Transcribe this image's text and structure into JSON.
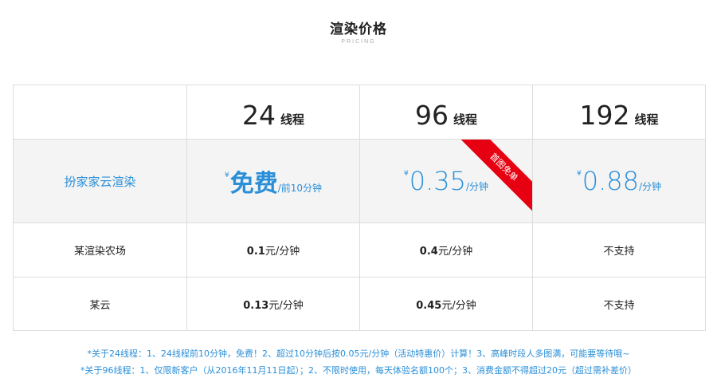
{
  "header": {
    "title": "渲染价格",
    "subtitle": "PRICING"
  },
  "table": {
    "columns": [
      {
        "threads": "24",
        "unit": "线程"
      },
      {
        "threads": "96",
        "unit": "线程"
      },
      {
        "threads": "192",
        "unit": "线程"
      }
    ],
    "ours": {
      "name": "扮家家云渲染",
      "prices": [
        {
          "currency": "¥",
          "value": "免费",
          "unit": "/前10分钟"
        },
        {
          "currency": "¥",
          "value": "0.35",
          "unit": "/分钟"
        },
        {
          "currency": "¥",
          "value": "0.88",
          "unit": "/分钟"
        }
      ],
      "ribbon": "首图免单"
    },
    "farm": {
      "name": "某渲染农场",
      "values": [
        {
          "value": "0.1",
          "unit": "元/分钟"
        },
        {
          "value": "0.4",
          "unit": "元/分钟"
        },
        {
          "value": "",
          "unit": "不支持"
        }
      ]
    },
    "cloud": {
      "name": "某云",
      "values": [
        {
          "value": "0.13",
          "unit": "元/分钟"
        },
        {
          "value": "0.45",
          "unit": "元/分钟"
        },
        {
          "value": "",
          "unit": "不支持"
        }
      ]
    }
  },
  "notes": [
    "*关于24线程：1、24线程前10分钟，免费！2、超过10分钟后按0.05元/分钟（活动特惠价）计算！3、高峰时段人多图满，可能要等待哦~",
    "*关于96线程：1、仅限新客户（从2016年11月11日起）；2、不限时使用，每天体验名额100个；3、消费金额不得超过20元（超过需补差价）"
  ],
  "colors": {
    "accent": "#2b8fd8",
    "ribbon": "#e60012",
    "highlight_row_bg": "#f4f4f4",
    "border": "#dddddd"
  }
}
